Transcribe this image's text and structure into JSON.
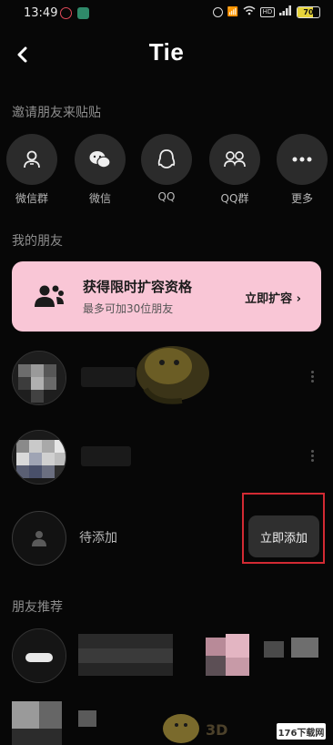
{
  "status_bar": {
    "time": "13:49",
    "battery": "70"
  },
  "header": {
    "title": "Tie"
  },
  "invite_section": {
    "label": "邀请朋友来贴贴",
    "items": [
      {
        "label": "微信群",
        "icon": "wechat-group-icon"
      },
      {
        "label": "微信",
        "icon": "wechat-icon"
      },
      {
        "label": "QQ",
        "icon": "qq-icon"
      },
      {
        "label": "QQ群",
        "icon": "qq-group-icon"
      },
      {
        "label": "更多",
        "icon": "more-icon"
      }
    ]
  },
  "friends_section": {
    "label": "我的朋友"
  },
  "promo": {
    "title": "获得限时扩容资格",
    "subtitle": "最多可加30位朋友",
    "cta": "立即扩容 ›"
  },
  "pending": {
    "label": "待添加",
    "button": "立即添加"
  },
  "recommend_section": {
    "label": "朋友推荐"
  },
  "watermark": {
    "text": "176下载网",
    "overlay": "3D"
  },
  "colors": {
    "background": "#070707",
    "promo_bg": "#f9c6d6",
    "highlight": "#d32a33",
    "button_bg": "#2f2f2f"
  }
}
